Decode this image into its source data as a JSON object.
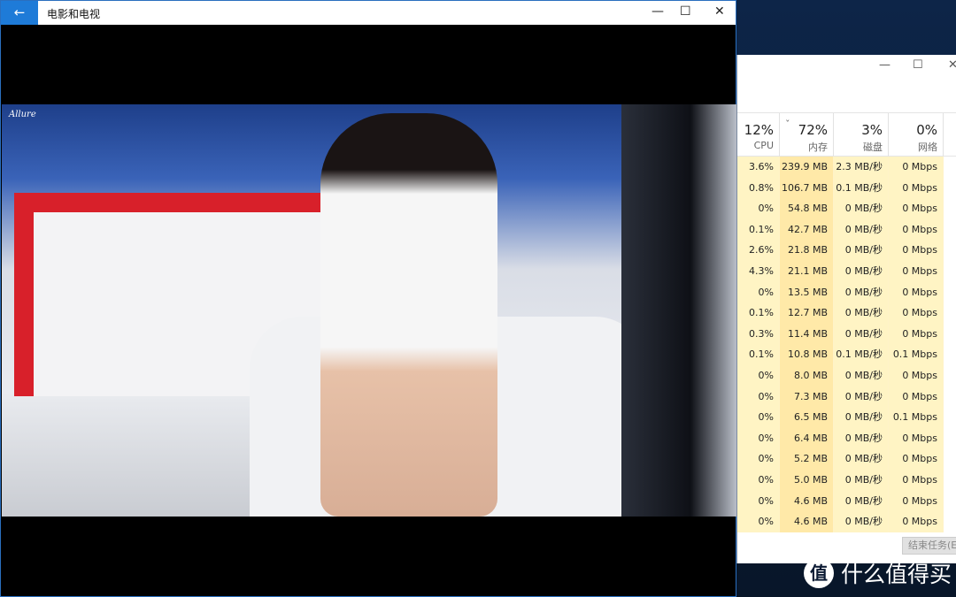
{
  "movies_app": {
    "title": "电影和电视",
    "back_icon": "←",
    "minimize": "—",
    "maximize": "☐",
    "close": "✕",
    "watermark": "Allure"
  },
  "task_manager": {
    "minimize": "—",
    "maximize": "☐",
    "close": "✕",
    "columns": [
      {
        "pct": "12%",
        "label": "CPU"
      },
      {
        "pct": "72%",
        "label": "内存",
        "sorted": "ˇ"
      },
      {
        "pct": "3%",
        "label": "磁盘"
      },
      {
        "pct": "0%",
        "label": "网络"
      }
    ],
    "rows": [
      [
        "3.6%",
        "239.9 MB",
        "2.3 MB/秒",
        "0 Mbps"
      ],
      [
        "0.8%",
        "106.7 MB",
        "0.1 MB/秒",
        "0 Mbps"
      ],
      [
        "0%",
        "54.8 MB",
        "0 MB/秒",
        "0 Mbps"
      ],
      [
        "0.1%",
        "42.7 MB",
        "0 MB/秒",
        "0 Mbps"
      ],
      [
        "2.6%",
        "21.8 MB",
        "0 MB/秒",
        "0 Mbps"
      ],
      [
        "4.3%",
        "21.1 MB",
        "0 MB/秒",
        "0 Mbps"
      ],
      [
        "0%",
        "13.5 MB",
        "0 MB/秒",
        "0 Mbps"
      ],
      [
        "0.1%",
        "12.7 MB",
        "0 MB/秒",
        "0 Mbps"
      ],
      [
        "0.3%",
        "11.4 MB",
        "0 MB/秒",
        "0 Mbps"
      ],
      [
        "0.1%",
        "10.8 MB",
        "0.1 MB/秒",
        "0.1 Mbps"
      ],
      [
        "0%",
        "8.0 MB",
        "0 MB/秒",
        "0 Mbps"
      ],
      [
        "0%",
        "7.3 MB",
        "0 MB/秒",
        "0 Mbps"
      ],
      [
        "0%",
        "6.5 MB",
        "0 MB/秒",
        "0.1 Mbps"
      ],
      [
        "0%",
        "6.4 MB",
        "0 MB/秒",
        "0 Mbps"
      ],
      [
        "0%",
        "5.2 MB",
        "0 MB/秒",
        "0 Mbps"
      ],
      [
        "0%",
        "5.0 MB",
        "0 MB/秒",
        "0 Mbps"
      ],
      [
        "0%",
        "4.6 MB",
        "0 MB/秒",
        "0 Mbps"
      ],
      [
        "0%",
        "4.6 MB",
        "0 MB/秒",
        "0 Mbps"
      ]
    ],
    "end_task": "结束任务(E)"
  },
  "watermark_logo": {
    "icon": "值",
    "text": "什么值得买"
  }
}
